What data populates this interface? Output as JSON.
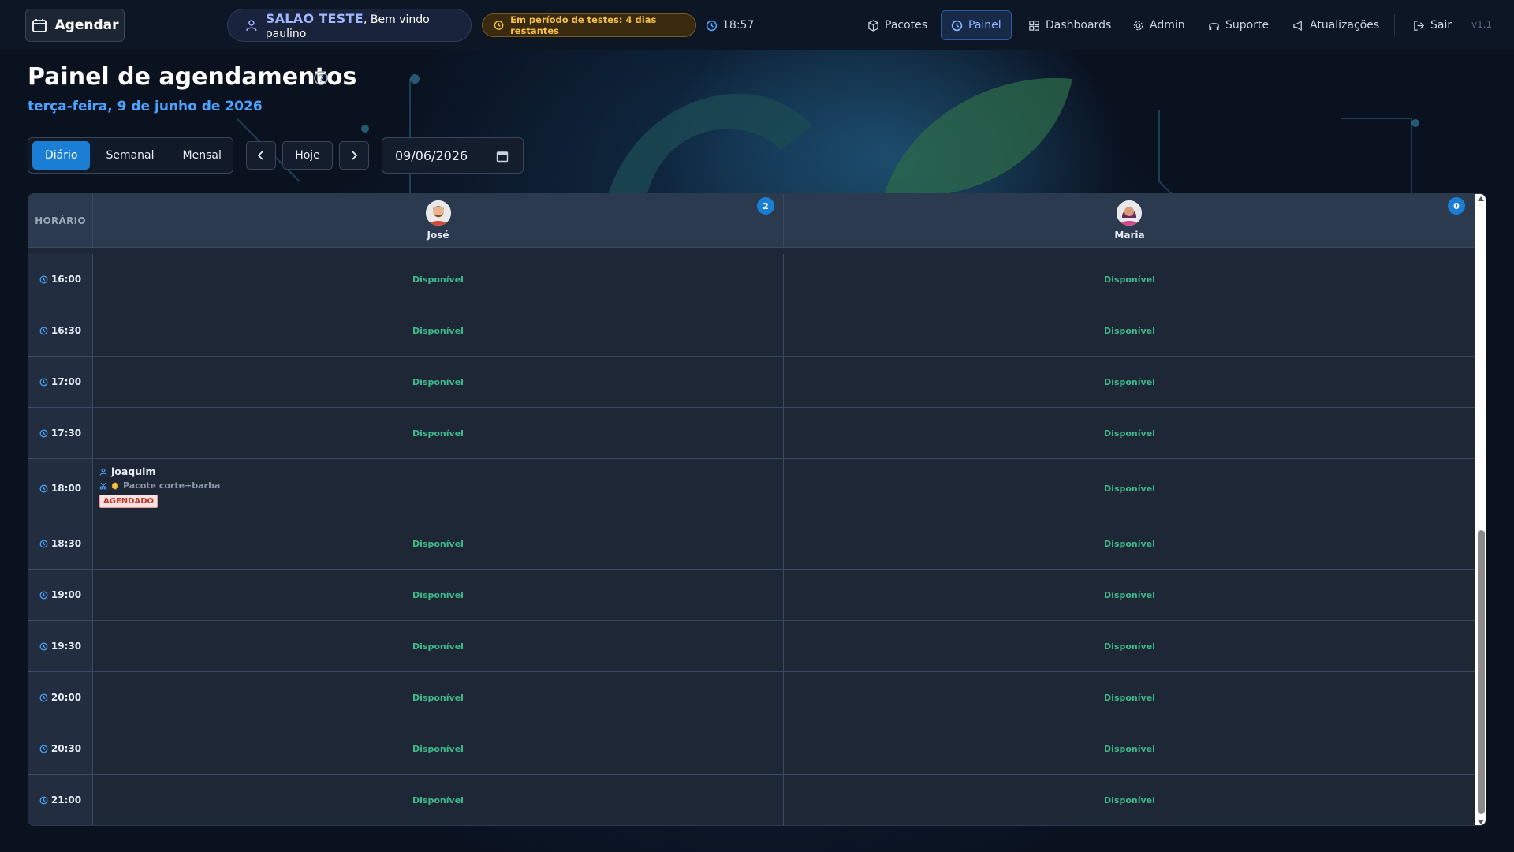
{
  "topbar": {
    "agendar_label": "Agendar",
    "salon_name": "SALAO TESTE",
    "welcome_text": ", Bem vindo paulino",
    "trial_text": "Em período de testes: 4 dias restantes",
    "time": "18:57",
    "nav": [
      {
        "label": "Pacotes",
        "icon": "box-icon",
        "active": false
      },
      {
        "label": "Painel",
        "icon": "clock-icon",
        "active": true
      },
      {
        "label": "Dashboards",
        "icon": "grid-icon",
        "active": false
      },
      {
        "label": "Admin",
        "icon": "gear-icon",
        "active": false
      },
      {
        "label": "Suporte",
        "icon": "headset-icon",
        "active": false
      },
      {
        "label": "Atualizações",
        "icon": "megaphone-icon",
        "active": false
      },
      {
        "label": "Sair",
        "icon": "logout-icon",
        "active": false
      }
    ],
    "version": "v1.1"
  },
  "header": {
    "title": "Painel de agendamentos",
    "date_line": "terça-feira, 9 de junho de 2026"
  },
  "controls": {
    "views": [
      "Diário",
      "Semanal",
      "Mensal"
    ],
    "active_view": "Diário",
    "today_label": "Hoje",
    "date_value": "09/06/2026"
  },
  "schedule": {
    "time_header": "HORÁRIO",
    "professionals": [
      {
        "name": "José",
        "count": "2"
      },
      {
        "name": "Maria",
        "count": "0"
      }
    ],
    "available_label": "Disponível",
    "slots": [
      {
        "time": "16:00"
      },
      {
        "time": "16:30"
      },
      {
        "time": "17:00"
      },
      {
        "time": "17:30"
      },
      {
        "time": "18:00",
        "appointment": {
          "client": "joaquim",
          "package": "Pacote corte+barba",
          "status": "AGENDADO"
        }
      },
      {
        "time": "18:30"
      },
      {
        "time": "19:00"
      },
      {
        "time": "19:30"
      },
      {
        "time": "20:00"
      },
      {
        "time": "20:30"
      },
      {
        "time": "21:00"
      }
    ]
  },
  "colors": {
    "accent": "#1a7fd4",
    "available": "#3fb98a",
    "status_scheduled": "#c0392b",
    "trial": "#f5c04a"
  }
}
